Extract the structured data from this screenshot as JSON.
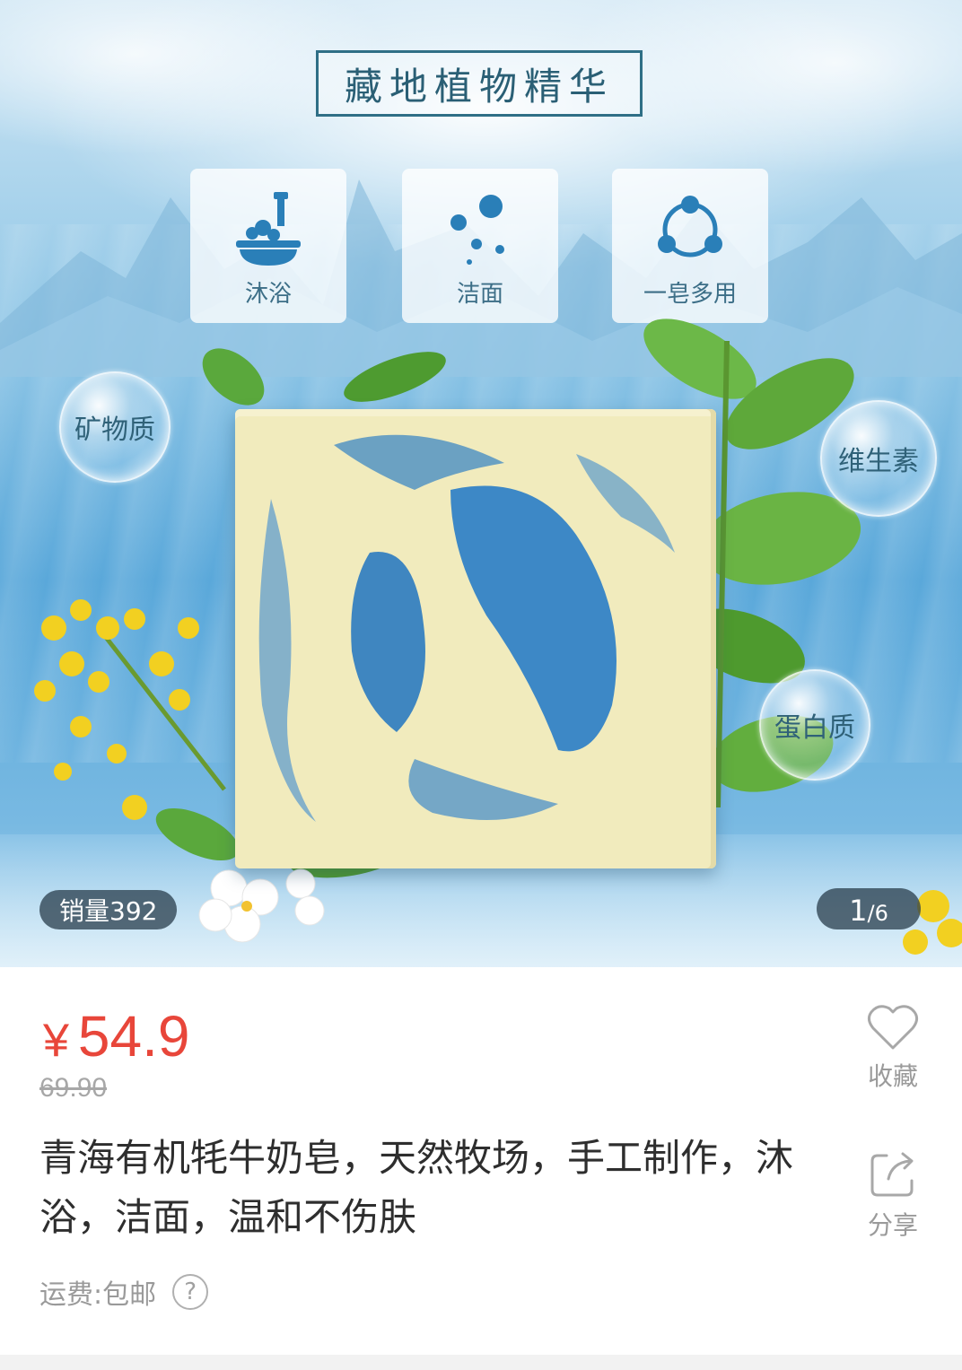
{
  "banner": {
    "headline": "藏地植物精华",
    "features": [
      {
        "icon": "bath-icon",
        "label": "沐浴"
      },
      {
        "icon": "bubbles-icon",
        "label": "洁面"
      },
      {
        "icon": "multi-use-icon",
        "label": "一皂多用"
      }
    ],
    "bubbles": [
      "矿物质",
      "维生素",
      "蛋白质"
    ],
    "sales": "销量392",
    "page_current": "1",
    "page_total": "/6"
  },
  "product": {
    "currency": "¥",
    "price": "54.9",
    "original_price": "69.90",
    "title": "青海有机牦牛奶皂，天然牧场，手工制作，沐浴，洁面，温和不伤肤",
    "shipping": "运费:包邮",
    "help_icon": "?"
  },
  "actions": {
    "favorite_label": "收藏",
    "favorite_icon": "heart-icon",
    "share_label": "分享",
    "share_icon": "share-icon"
  },
  "colors": {
    "price": "#e8463a",
    "accent_blue": "#3a8fc8",
    "muted_text": "#9a9a9a"
  }
}
